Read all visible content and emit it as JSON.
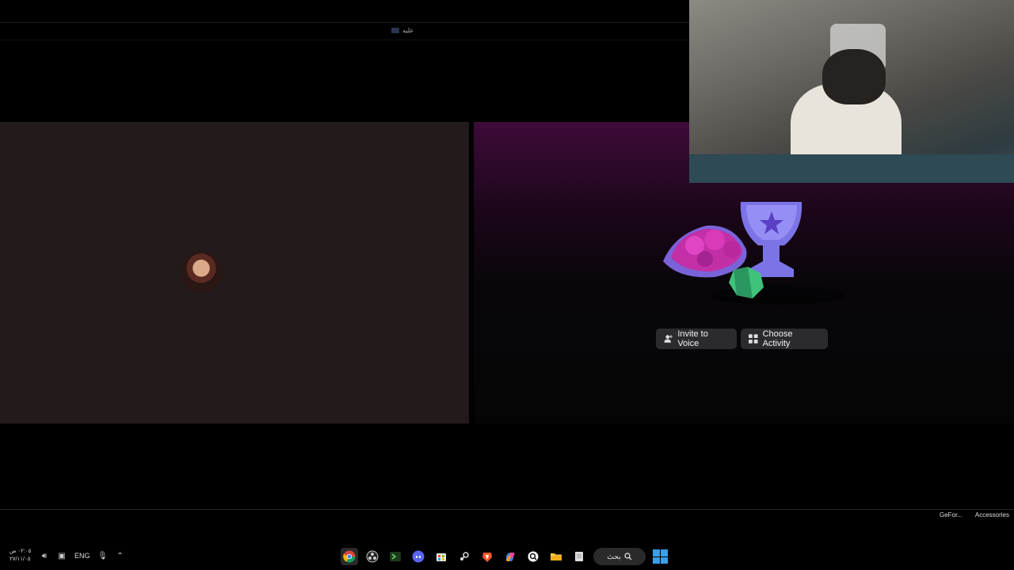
{
  "window": {
    "title": "عليه"
  },
  "call": {
    "buttons": {
      "invite_label": "Invite to Voice",
      "activity_label": "Choose Activity"
    }
  },
  "tray": {
    "labels": [
      "GeFor...",
      "Accessories"
    ]
  },
  "taskbar": {
    "clock_time": "٠٢:٠٥ ص",
    "clock_date": "٢٧/١١/٠٥",
    "language": "ENG",
    "search_label": "بحث",
    "apps": [
      "chrome-icon",
      "obs-icon",
      "terminal-icon",
      "discord-icon",
      "store-icon",
      "steam-icon",
      "brave-icon",
      "copilot-icon",
      "search-app-icon",
      "file-explorer-icon",
      "notepad-icon"
    ],
    "colors": {
      "accent": "#3aa0ea",
      "discord": "#5865f2"
    }
  }
}
